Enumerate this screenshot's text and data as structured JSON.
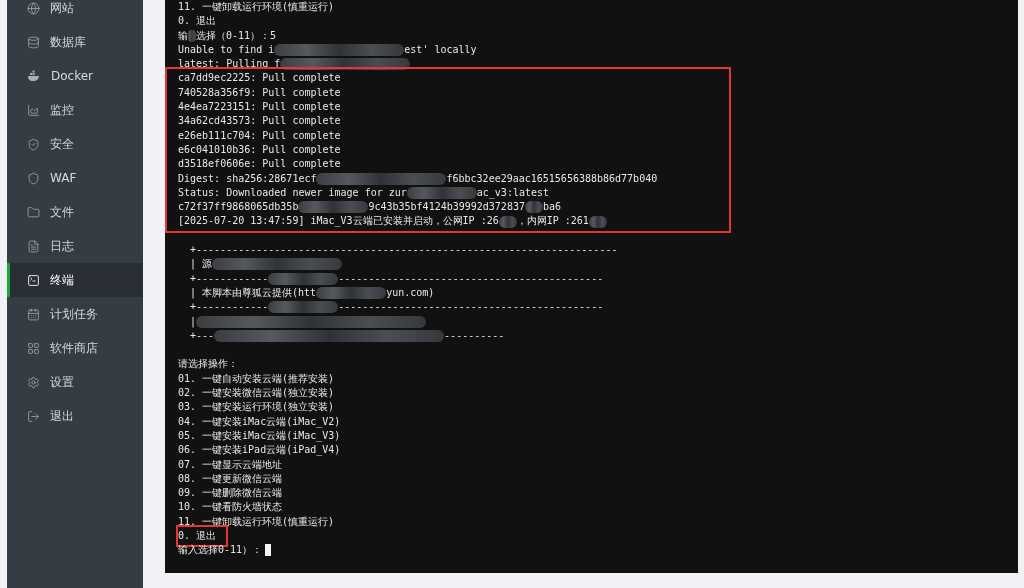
{
  "sidebar": {
    "items": [
      {
        "label": "网站",
        "selected": false
      },
      {
        "label": "数据库",
        "selected": false
      },
      {
        "label": "Docker",
        "selected": false
      },
      {
        "label": "监控",
        "selected": false
      },
      {
        "label": "安全",
        "selected": false
      },
      {
        "label": "WAF",
        "selected": false
      },
      {
        "label": "文件",
        "selected": false
      },
      {
        "label": "日志",
        "selected": false
      },
      {
        "label": "终端",
        "selected": true
      },
      {
        "label": "计划任务",
        "selected": false
      },
      {
        "label": "软件商店",
        "selected": false
      },
      {
        "label": "设置",
        "selected": false
      },
      {
        "label": "退出",
        "selected": false
      }
    ]
  },
  "terminal": {
    "blocks": [
      {
        "highlighted": false,
        "lines": [
          {
            "kind": "text",
            "parts": [
              {
                "kind": "text",
                "text": "11. 一键卸载运行环境(慎重运行)"
              }
            ]
          },
          {
            "kind": "text",
            "parts": [
              {
                "kind": "text",
                "text": "0. 退出"
              }
            ]
          },
          {
            "kind": "text",
            "parts": [
              {
                "kind": "text",
                "text": "输"
              },
              {
                "kind": "blur-tiny"
              },
              {
                "kind": "text",
                "text": "选择（0-11）：5"
              }
            ]
          },
          {
            "kind": "text",
            "parts": [
              {
                "kind": "text",
                "text": "Unable to find i"
              },
              {
                "kind": "blur-large"
              },
              {
                "kind": "text",
                "text": "est' locally"
              }
            ]
          },
          {
            "kind": "text",
            "parts": [
              {
                "kind": "text",
                "text": "latest: Pulling f"
              },
              {
                "kind": "blur-large"
              }
            ]
          }
        ]
      },
      {
        "highlighted": true,
        "lines": [
          {
            "kind": "text",
            "parts": [
              {
                "kind": "text",
                "text": "ca7dd9ec2225: Pull complete"
              }
            ]
          },
          {
            "kind": "text",
            "parts": [
              {
                "kind": "text",
                "text": "740528a356f9: Pull complete"
              }
            ]
          },
          {
            "kind": "text",
            "parts": [
              {
                "kind": "text",
                "text": "4e4ea7223151: Pull complete"
              }
            ]
          },
          {
            "kind": "text",
            "parts": [
              {
                "kind": "text",
                "text": "34a62cd43573: Pull complete"
              }
            ]
          },
          {
            "kind": "text",
            "parts": [
              {
                "kind": "text",
                "text": "e26eb111c704: Pull complete"
              }
            ]
          },
          {
            "kind": "text",
            "parts": [
              {
                "kind": "text",
                "text": "e6c041010b36: Pull complete"
              }
            ]
          },
          {
            "kind": "text",
            "parts": [
              {
                "kind": "text",
                "text": "d3518ef0606e: Pull complete"
              }
            ]
          },
          {
            "kind": "text",
            "parts": [
              {
                "kind": "text",
                "text": "Digest: sha256:28671ecf"
              },
              {
                "kind": "blur-large"
              },
              {
                "kind": "text",
                "text": "f6bbc32ee29aac16515656388b86d77b040"
              }
            ]
          },
          {
            "kind": "text",
            "parts": [
              {
                "kind": "text",
                "text": "Status: Downloaded newer image for zur"
              },
              {
                "kind": "blur-medium"
              },
              {
                "kind": "text",
                "text": "ac_v3:latest"
              }
            ]
          },
          {
            "kind": "text",
            "parts": [
              {
                "kind": "text",
                "text": "c72f37ff9868065db35b"
              },
              {
                "kind": "blur-medium"
              },
              {
                "kind": "text",
                "text": "9c43b35bf4124b39992d372837"
              },
              {
                "kind": "blur-small"
              },
              {
                "kind": "text",
                "text": "ba6"
              }
            ]
          },
          {
            "kind": "text",
            "parts": [
              {
                "kind": "text",
                "text": "[2025-07-20 13:47:59] iMac_V3云端已安装并启动，公网IP :26"
              },
              {
                "kind": "blur-small"
              },
              {
                "kind": "text",
                "text": "，内网IP :261"
              },
              {
                "kind": "blur-small"
              }
            ]
          }
        ]
      },
      {
        "highlighted": false,
        "lines": [
          {
            "kind": "blank"
          },
          {
            "kind": "box",
            "parts": [
              {
                "kind": "text",
                "text": "+----------------------------------------------------------------------"
              }
            ]
          },
          {
            "kind": "box",
            "parts": [
              {
                "kind": "text",
                "text": "| 源"
              },
              {
                "kind": "blur-large"
              }
            ]
          },
          {
            "kind": "box",
            "parts": [
              {
                "kind": "text",
                "text": "+------------"
              },
              {
                "kind": "blur-medium"
              },
              {
                "kind": "text",
                "text": "--------------------------------------------"
              }
            ]
          },
          {
            "kind": "box",
            "parts": [
              {
                "kind": "text",
                "text": "| 本脚本由尊狐云提供(htt"
              },
              {
                "kind": "blur-medium"
              },
              {
                "kind": "text",
                "text": "yun.com)"
              }
            ]
          },
          {
            "kind": "box",
            "parts": [
              {
                "kind": "text",
                "text": "+------------"
              },
              {
                "kind": "blur-medium"
              },
              {
                "kind": "text",
                "text": "--------------------------------------------"
              }
            ]
          },
          {
            "kind": "box",
            "parts": [
              {
                "kind": "text",
                "text": "|"
              },
              {
                "kind": "blur-huge"
              }
            ]
          },
          {
            "kind": "box",
            "parts": [
              {
                "kind": "text",
                "text": "+---"
              },
              {
                "kind": "blur-huge"
              },
              {
                "kind": "text",
                "text": "----------"
              }
            ]
          },
          {
            "kind": "blank"
          },
          {
            "kind": "text",
            "parts": [
              {
                "kind": "text",
                "text": "请选择操作："
              }
            ]
          },
          {
            "kind": "text",
            "parts": [
              {
                "kind": "text",
                "text": "01. 一键自动安装云端(推荐安装)"
              }
            ]
          },
          {
            "kind": "text",
            "parts": [
              {
                "kind": "text",
                "text": "02. 一键安装微信云端(独立安装)"
              }
            ]
          },
          {
            "kind": "text",
            "parts": [
              {
                "kind": "text",
                "text": "03. 一键安装运行环境(独立安装)"
              }
            ]
          },
          {
            "kind": "text",
            "parts": [
              {
                "kind": "text",
                "text": "04. 一键安装iMac云端(iMac_V2)"
              }
            ]
          },
          {
            "kind": "text",
            "parts": [
              {
                "kind": "text",
                "text": "05. 一键安装iMac云端(iMac_V3)"
              }
            ]
          },
          {
            "kind": "text",
            "parts": [
              {
                "kind": "text",
                "text": "06. 一键安装iPad云端(iPad_V4)"
              }
            ]
          },
          {
            "kind": "text",
            "parts": [
              {
                "kind": "text",
                "text": "07. 一键显示云端地址"
              }
            ]
          },
          {
            "kind": "text",
            "parts": [
              {
                "kind": "text",
                "text": "08. 一键更新微信云端"
              }
            ]
          },
          {
            "kind": "text",
            "parts": [
              {
                "kind": "text",
                "text": "09. 一键删除微信云端"
              }
            ]
          },
          {
            "kind": "text",
            "parts": [
              {
                "kind": "text",
                "text": "10. 一键看防火墙状态"
              }
            ]
          },
          {
            "kind": "text",
            "parts": [
              {
                "kind": "text",
                "text": "11. 一键卸载运行环境(慎重运行)"
              }
            ]
          }
        ]
      },
      {
        "highlighted": true,
        "lines": [
          {
            "kind": "text",
            "parts": [
              {
                "kind": "text",
                "text": "0. 退出"
              }
            ]
          }
        ]
      },
      {
        "highlighted": false,
        "lines": [
          {
            "kind": "prompt",
            "parts": [
              {
                "kind": "text",
                "text": "输入选择0-11）："
              }
            ]
          }
        ]
      }
    ]
  }
}
